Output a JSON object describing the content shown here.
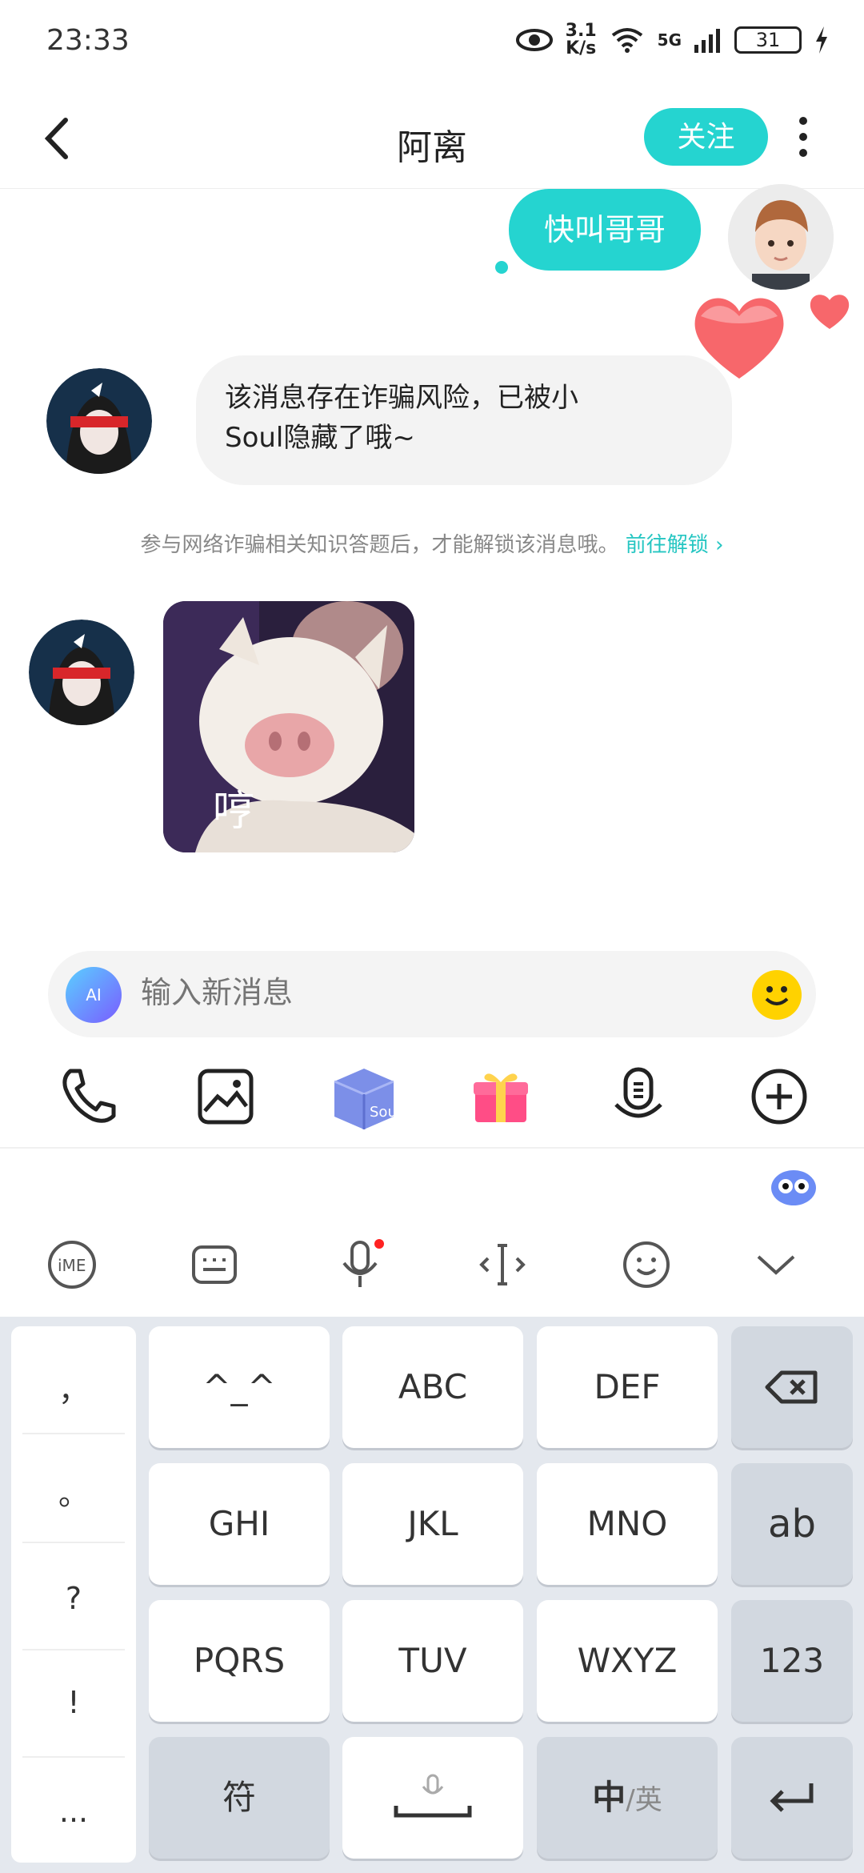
{
  "status": {
    "time": "23:33",
    "net_speed_top": "3.1",
    "net_speed_bottom": "K/s",
    "network": "5G",
    "battery": "31"
  },
  "header": {
    "title": "阿离",
    "follow_label": "关注"
  },
  "messages": {
    "outgoing_text": "快叫哥哥",
    "incoming_line1": "该消息存在诈骗风险，已被小",
    "incoming_line2": "Soul隐藏了哦~",
    "notice_text": "参与网络诈骗相关知识答题后，才能解锁该消息哦。",
    "notice_link": "前往解锁",
    "sticker_caption": "哼"
  },
  "input": {
    "placeholder": "输入新消息",
    "ai_label": "AI"
  },
  "toolbar": {
    "soul_box_label": "Soul"
  },
  "keyboard": {
    "side_keys": [
      "，",
      "。",
      "?",
      "!",
      "..."
    ],
    "row1": [
      "^_^",
      "ABC",
      "DEF"
    ],
    "row2": [
      "GHI",
      "JKL",
      "MNO"
    ],
    "row3": [
      "PQRS",
      "TUV",
      "WXYZ"
    ],
    "right_keys": {
      "ab": "ab",
      "num": "123"
    },
    "symbol_key": "符",
    "lang_main": "中",
    "lang_alt": "/英"
  },
  "colors": {
    "accent": "#25d4d0",
    "heart": "#f7676b",
    "keyboard_bg": "#e4e8ee"
  }
}
